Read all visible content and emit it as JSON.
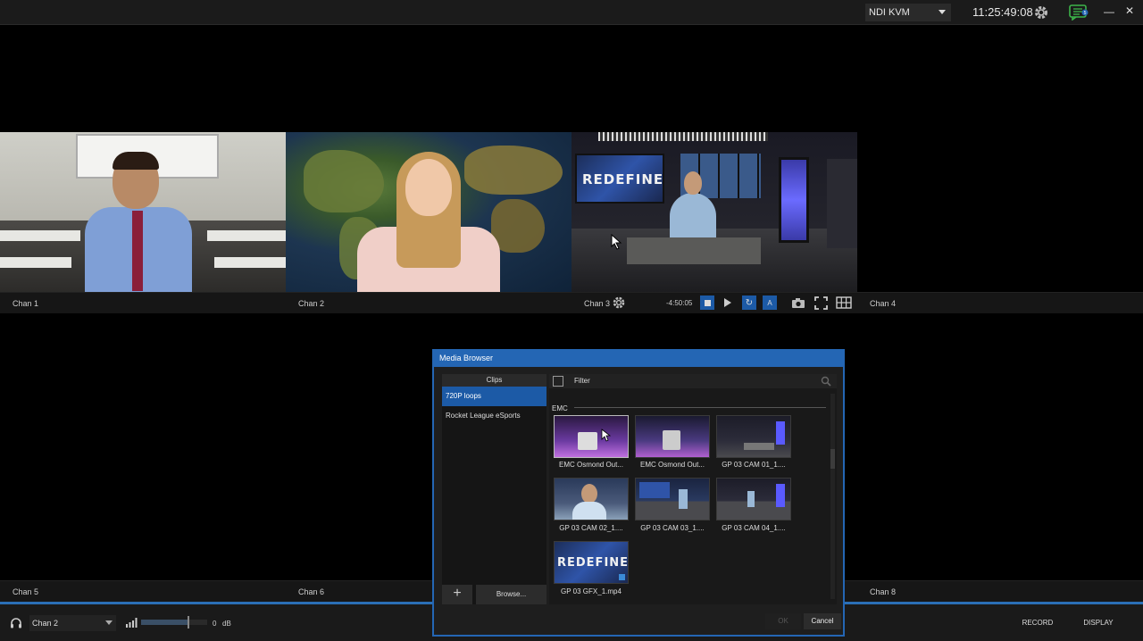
{
  "topbar": {
    "source_selector": "NDI KVM",
    "clock": "11:25:49:08",
    "chat_badge": "5"
  },
  "channels": [
    {
      "label": "Chan 1"
    },
    {
      "label": "Chan 2"
    },
    {
      "label": "Chan 3"
    },
    {
      "label": "Chan 4"
    },
    {
      "label": "Chan 5"
    },
    {
      "label": "Chan 6"
    },
    {
      "label": "Chan 8"
    }
  ],
  "chan3_controls": {
    "timecode": "-4:50:05",
    "auto_label": "A"
  },
  "tile_graphics": {
    "redefine_text": "REDEFINE"
  },
  "bottombar": {
    "audio_source": "Chan 2",
    "volume_value": "0",
    "volume_unit": "dB",
    "record_label": "RECORD",
    "display_label": "DISPLAY",
    "volume_level": 0.7
  },
  "media_browser": {
    "title": "Media Browser",
    "left_header": "Clips",
    "left_items": [
      "720P loops",
      "Rocket League eSports"
    ],
    "add_symbol": "+",
    "browse_label": "Browse...",
    "filter_label": "Filter",
    "group_label": "EMC",
    "thumbnails": [
      {
        "label": "EMC Osmond Out..."
      },
      {
        "label": "EMC Osmond Out..."
      },
      {
        "label": "GP 03 CAM 01_1...."
      },
      {
        "label": "GP 03 CAM 02_1...."
      },
      {
        "label": "GP 03 CAM 03_1...."
      },
      {
        "label": "GP 03 CAM 04_1...."
      },
      {
        "label": "GP 03 GFX_1.mp4"
      }
    ],
    "ok_label": "OK",
    "cancel_label": "Cancel"
  },
  "colors": {
    "accent": "#2466b4",
    "selected": "#1c5aa6"
  }
}
